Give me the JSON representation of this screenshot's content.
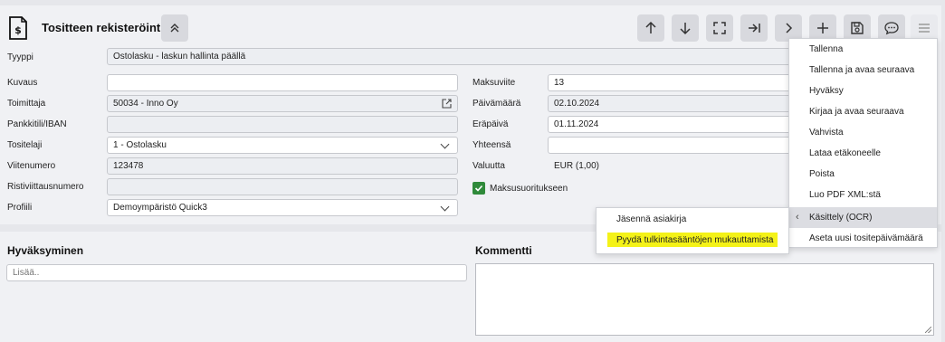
{
  "header": {
    "title": "Tositteen rekisteröinti",
    "toolbar_icons": [
      "arrow-up-icon",
      "arrow-down-icon",
      "fullscreen-icon",
      "send-to-icon",
      "chevron-right-icon",
      "plus-icon",
      "save-icon",
      "comment-icon",
      "hamburger-menu-icon"
    ]
  },
  "form": {
    "type": {
      "label": "Tyyppi",
      "value": "Ostolasku - laskun hallinta päällä"
    },
    "description": {
      "label": "Kuvaus",
      "value": ""
    },
    "supplier": {
      "label": "Toimittaja",
      "value": "50034 - Inno Oy"
    },
    "iban": {
      "label": "Pankkitili/IBAN",
      "value": ""
    },
    "voucher_type": {
      "label": "Tositelaji",
      "value": "1 - Ostolasku"
    },
    "reference": {
      "label": "Viitenumero",
      "value": "123478"
    },
    "cross_reference": {
      "label": "Ristiviittausnumero",
      "value": ""
    },
    "profile": {
      "label": "Profiili",
      "value": "Demoympäristö Quick3"
    },
    "payment_ref": {
      "label": "Maksuviite",
      "value": "13"
    },
    "date": {
      "label": "Päivämäärä",
      "value": "02.10.2024"
    },
    "due_date": {
      "label": "Eräpäivä",
      "value": "01.11.2024"
    },
    "total": {
      "label": "Yhteensä",
      "value": ""
    },
    "currency": {
      "label": "Valuutta",
      "value": "EUR (1,00)"
    },
    "payment_order": {
      "label": "Maksusuoritukseen",
      "checked": true
    }
  },
  "approval": {
    "title": "Hyväksyminen",
    "placeholder": "Lisää.."
  },
  "comment": {
    "title": "Kommentti",
    "value": ""
  },
  "menu": {
    "items": [
      {
        "label": "Tallenna"
      },
      {
        "label": "Tallenna ja avaa seuraava"
      },
      {
        "label": "Hyväksy"
      },
      {
        "label": "Kirjaa ja avaa seuraava"
      },
      {
        "label": "Vahvista"
      },
      {
        "label": "Lataa etäkoneelle"
      },
      {
        "label": "Poista"
      },
      {
        "label": "Luo PDF XML:stä"
      },
      {
        "label": "Käsittely (OCR)",
        "active": true
      },
      {
        "label": "Aseta uusi tositepäivämäärä"
      }
    ],
    "submenu": [
      {
        "label": "Jäsennä asiakirja"
      },
      {
        "label": "Pyydä tulkintasääntöjen mukauttamista",
        "highlighted": true
      }
    ]
  },
  "colors": {
    "accent_check": "#2f8a3a",
    "highlight": "#f4f218"
  }
}
